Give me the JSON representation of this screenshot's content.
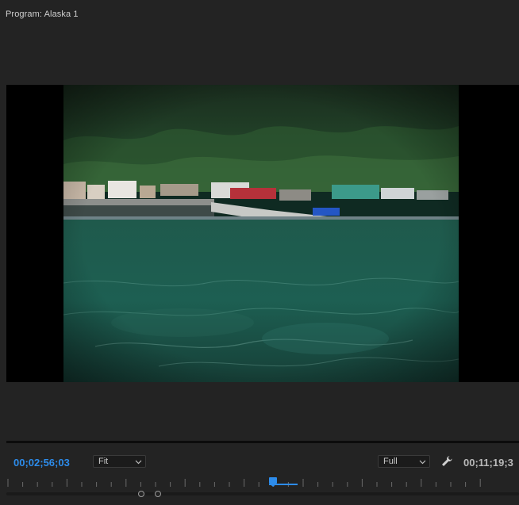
{
  "panel": {
    "title": "Program: Alaska 1"
  },
  "program_monitor": {
    "current_timecode": "00;02;56;03",
    "duration_timecode": "00;11;19;3",
    "zoom": {
      "selected": "Fit"
    },
    "resolution": {
      "selected": "Full"
    },
    "playhead_position_fraction": 0.52,
    "settings_icon": "wrench-icon"
  },
  "colors": {
    "background": "#232323",
    "current_timecode": "#2d8ceb",
    "playhead": "#2d8ceb",
    "letterbox": "#000000"
  }
}
